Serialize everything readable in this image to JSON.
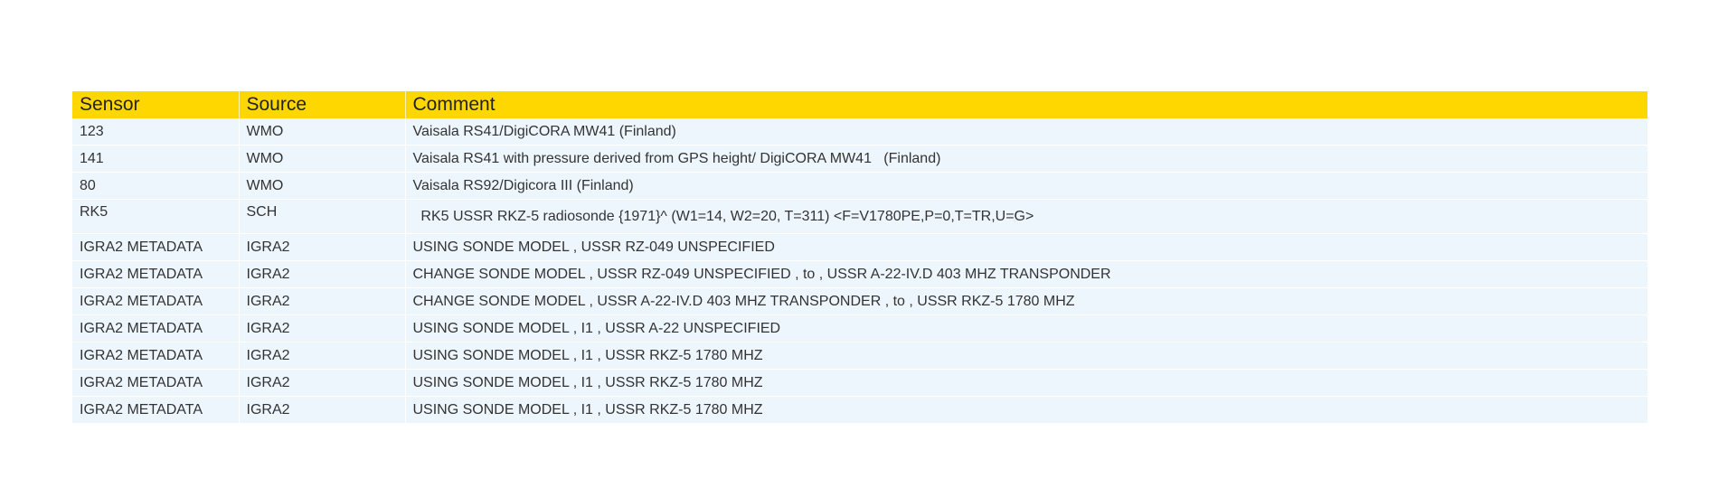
{
  "table": {
    "headers": [
      "Sensor",
      "Source",
      "Comment"
    ],
    "rows": [
      [
        "123",
        "WMO",
        "Vaisala RS41/DigiCORA MW41 (Finland)"
      ],
      [
        "141",
        "WMO",
        "Vaisala RS41 with pressure derived from GPS height/ DigiCORA MW41   (Finland)"
      ],
      [
        "80",
        "WMO",
        "Vaisala RS92/Digicora III (Finland)"
      ],
      [
        "RK5",
        "SCH",
        "  RK5 USSR RKZ-5 radiosonde {1971}^ (W1=14, W2=20, T=311) <F=V1780PE,P=0,T=TR,U=G>"
      ],
      [
        "IGRA2 METADATA",
        "IGRA2",
        "USING SONDE MODEL , USSR RZ-049 UNSPECIFIED"
      ],
      [
        "IGRA2 METADATA",
        "IGRA2",
        "CHANGE SONDE MODEL , USSR RZ-049 UNSPECIFIED , to , USSR A-22-IV.D 403 MHZ TRANSPONDER"
      ],
      [
        "IGRA2 METADATA",
        "IGRA2",
        "CHANGE SONDE MODEL , USSR A-22-IV.D 403 MHZ TRANSPONDER , to , USSR RKZ-5 1780 MHZ"
      ],
      [
        "IGRA2 METADATA",
        "IGRA2",
        "USING SONDE MODEL , I1 , USSR A-22 UNSPECIFIED"
      ],
      [
        "IGRA2 METADATA",
        "IGRA2",
        "USING SONDE MODEL , I1 , USSR RKZ-5 1780 MHZ"
      ],
      [
        "IGRA2 METADATA",
        "IGRA2",
        "USING SONDE MODEL , I1 , USSR RKZ-5 1780 MHZ"
      ],
      [
        "IGRA2 METADATA",
        "IGRA2",
        "USING SONDE MODEL , I1 , USSR RKZ-5 1780 MHZ"
      ]
    ]
  },
  "colors": {
    "header_bg": "#ffd700",
    "row_bg": "#eef6fd"
  }
}
